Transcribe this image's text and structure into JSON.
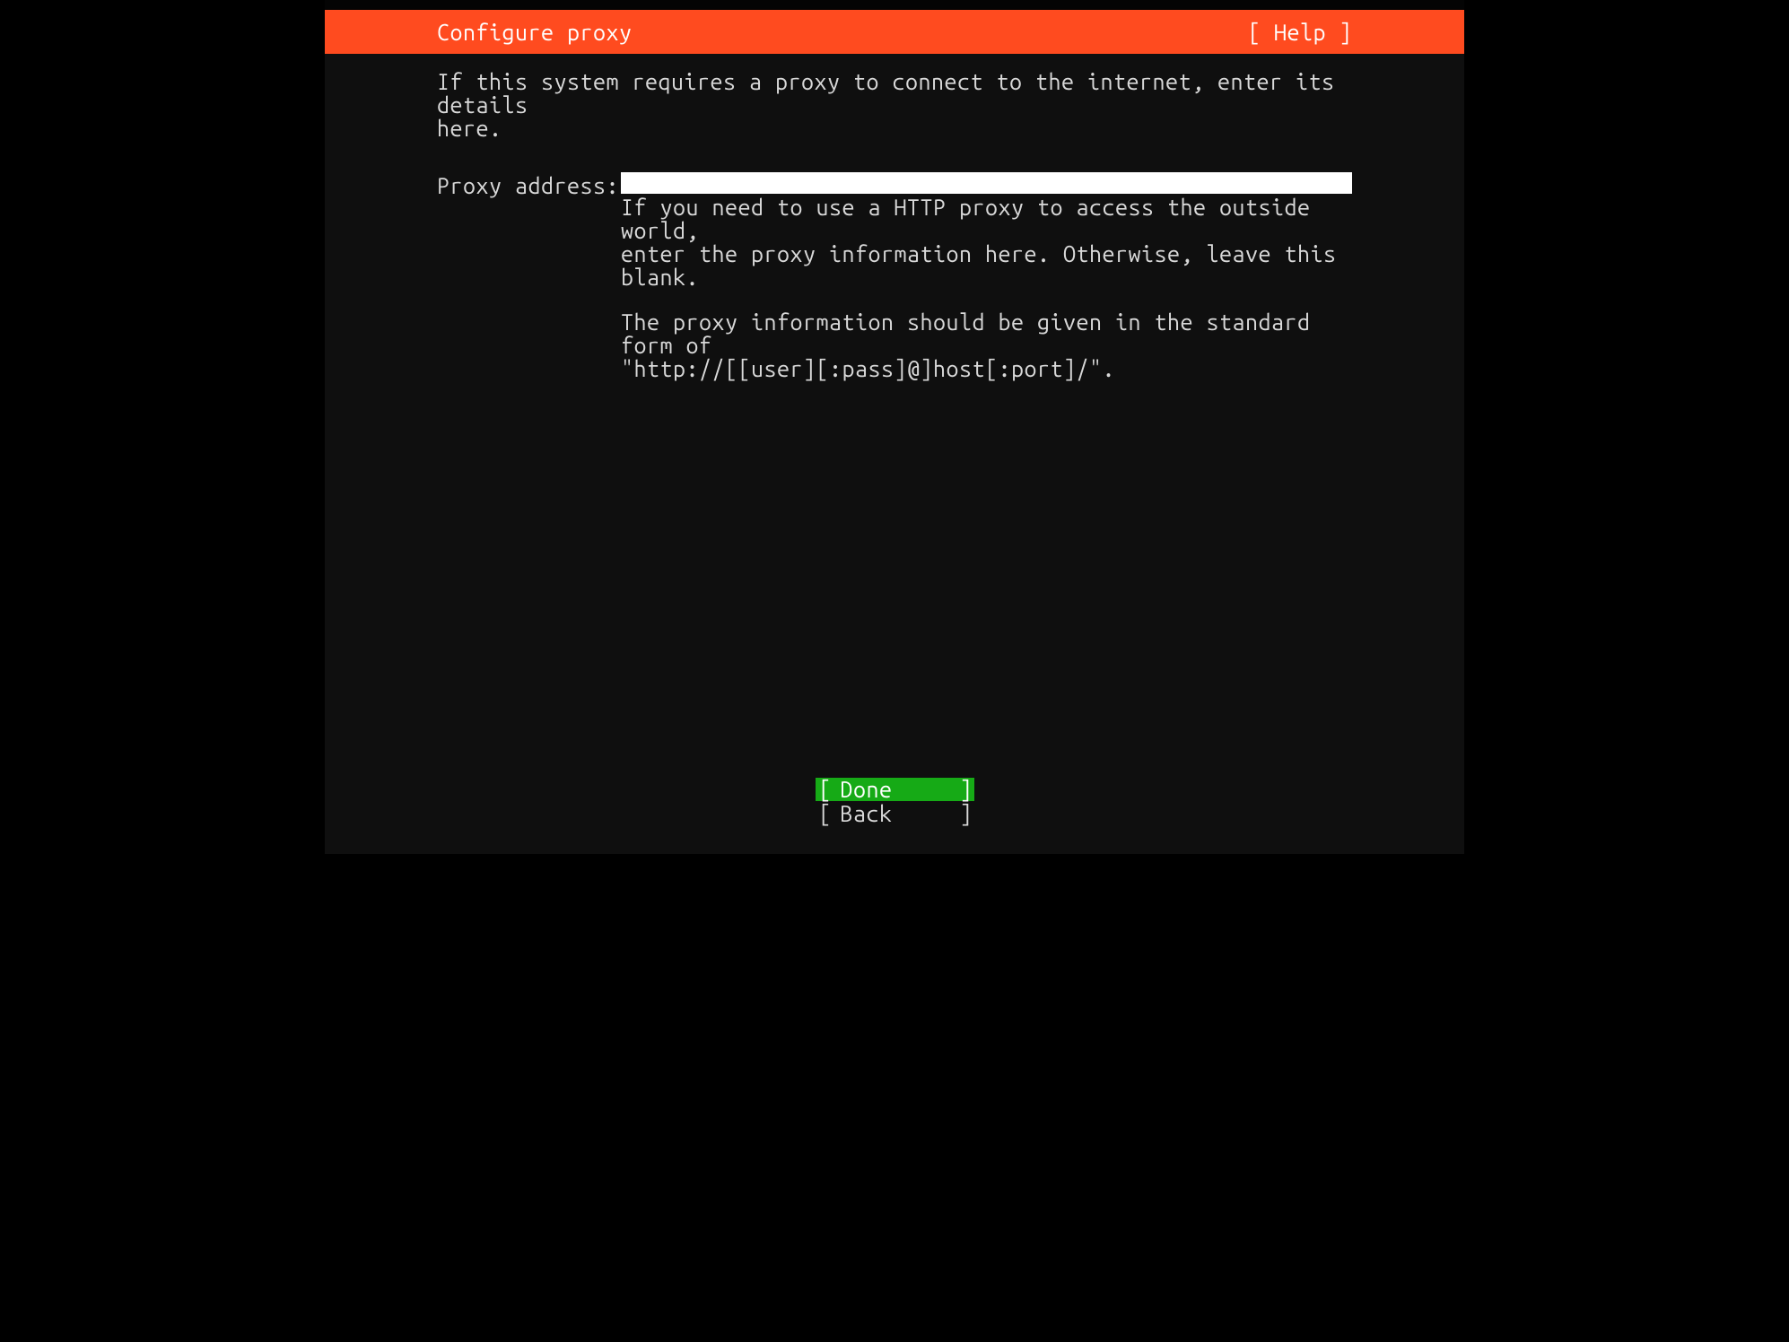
{
  "header": {
    "title": "Configure proxy",
    "help": "[ Help ]"
  },
  "content": {
    "intro": "If this system requires a proxy to connect to the internet, enter its details\nhere.",
    "field_label": "Proxy address:",
    "proxy_value": "",
    "help1": "If you need to use a HTTP proxy to access the outside world,\nenter the proxy information here. Otherwise, leave this blank.",
    "help2": "The proxy information should be given in the standard form of\n\"http://[[user][:pass]@]host[:port]/\"."
  },
  "buttons": {
    "done": {
      "left": "[",
      "label": "Done",
      "right": "]"
    },
    "back": {
      "left": "[",
      "label": "Back",
      "right": "]"
    }
  }
}
